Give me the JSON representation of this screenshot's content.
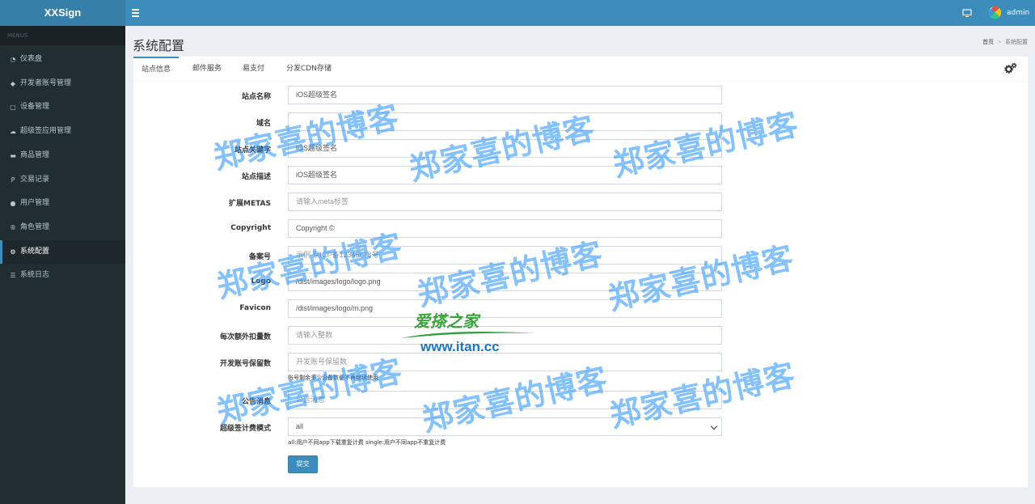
{
  "app": {
    "brand": "XXSign",
    "user": "admin"
  },
  "colors": {
    "header": "#3c8dbc",
    "sidebar": "#222d32",
    "primary": "#3c8dbc",
    "watermark": "#1e90ff"
  },
  "sidebar": {
    "section_label": "MENUS",
    "items": [
      {
        "label": "仪表盘",
        "icon": "dashboard-icon",
        "glyph": "◔"
      },
      {
        "label": "开发者账号管理",
        "icon": "tags-icon",
        "glyph": "◆"
      },
      {
        "label": "设备管理",
        "icon": "copy-icon",
        "glyph": "▢"
      },
      {
        "label": "超级签应用管理",
        "icon": "comments-icon",
        "glyph": "☁"
      },
      {
        "label": "商品管理",
        "icon": "keyboard-icon",
        "glyph": "▬"
      },
      {
        "label": "交易记录",
        "icon": "paypal-icon",
        "glyph": "P"
      },
      {
        "label": "用户管理",
        "icon": "user-icon",
        "glyph": "●"
      },
      {
        "label": "角色管理",
        "icon": "registered-icon",
        "glyph": "®"
      },
      {
        "label": "系统配置",
        "icon": "cog-icon",
        "glyph": "⚙",
        "active": true
      },
      {
        "label": "系统日志",
        "icon": "list-icon",
        "glyph": "☰"
      }
    ]
  },
  "page": {
    "title": "系统配置",
    "breadcrumb": [
      "首页",
      "系统配置"
    ]
  },
  "tabs": [
    "站点信息",
    "邮件服务",
    "易支付",
    "分发CDN存储"
  ],
  "form": {
    "fields": [
      {
        "label": "站点名称",
        "value": "iOS超级签名",
        "placeholder": ""
      },
      {
        "label": "域名",
        "value": "",
        "placeholder": ""
      },
      {
        "label": "站点关键字",
        "value": "iOS超级签名",
        "placeholder": ""
      },
      {
        "label": "站点描述",
        "value": "iOS超级签名",
        "placeholder": ""
      },
      {
        "label": "扩展METAS",
        "value": "",
        "placeholder": "请输入meta标签"
      },
      {
        "label": "Copyright",
        "value": "Copyright ©",
        "placeholder": ""
      },
      {
        "label": "备案号",
        "value": "",
        "placeholder": "示例 京ICP备12345678号"
      },
      {
        "label": "Logo",
        "value": "/dist/images/logo/logo.png",
        "placeholder": ""
      },
      {
        "label": "Favicon",
        "value": "/dist/images/logo/m.png",
        "placeholder": ""
      },
      {
        "label": "每次额外扣量数",
        "value": "",
        "placeholder": "请输入整数"
      },
      {
        "label": "开发账号保留数",
        "value": "",
        "placeholder": "开发账号保留数",
        "help": "账号剩余多少设备数便不再继续使用"
      },
      {
        "label": "公告消息",
        "value": "",
        "placeholder": "公告消息"
      },
      {
        "label": "超级签计费模式",
        "value": "all",
        "placeholder": "",
        "help": "all:用户不同app下载重复计费 single:用户不同app不重复计费",
        "type": "select"
      }
    ],
    "submit_label": "提交"
  },
  "watermark": {
    "text": "郑家喜的博客",
    "logo_title": "爱搽之家",
    "logo_url": "www.itan.cc"
  }
}
